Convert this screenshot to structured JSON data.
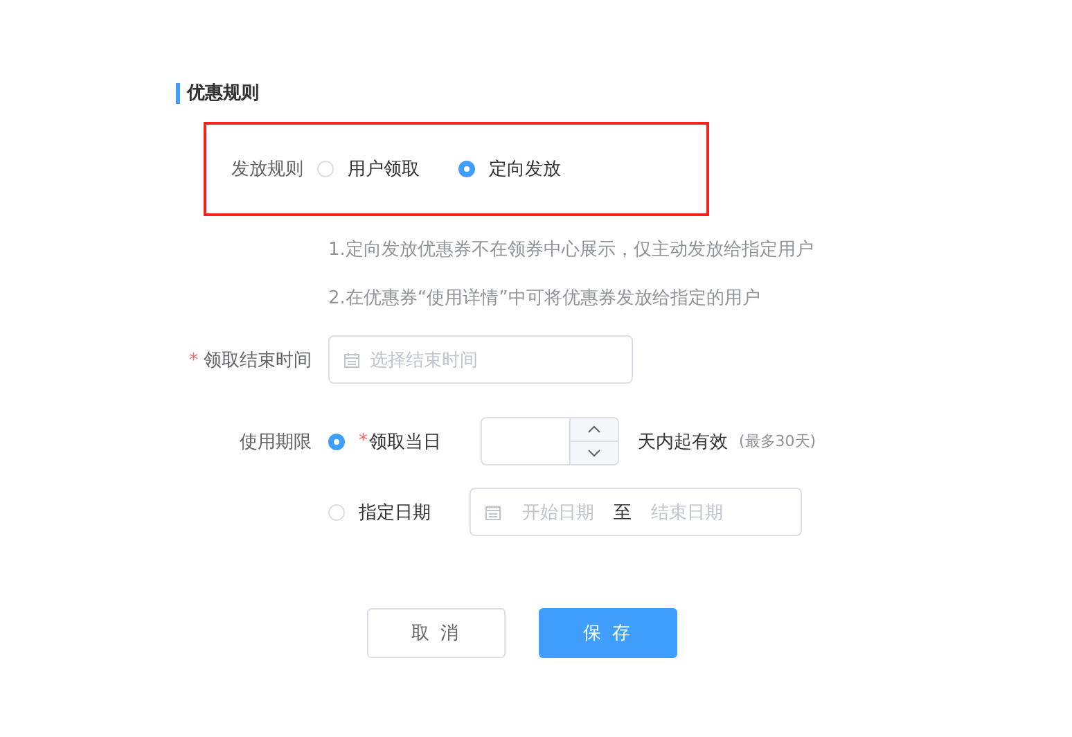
{
  "section": {
    "title": "优惠规则"
  },
  "issue_rule": {
    "label": "发放规则",
    "highlighted": true,
    "options": [
      {
        "label": "用户领取",
        "selected": false
      },
      {
        "label": "定向发放",
        "selected": true
      }
    ]
  },
  "notes": [
    "1.定向发放优惠券不在领券中心展示，仅主动发放给指定用户",
    "2.在优惠券“使用详情”中可将优惠券发放给指定的用户"
  ],
  "end_time": {
    "required_mark": "*",
    "label": "领取结束时间",
    "placeholder": "选择结束时间"
  },
  "validity": {
    "label": "使用期限",
    "options": [
      {
        "kind": "days",
        "required_mark": "*",
        "label": "领取当日",
        "selected": true,
        "suffix": "天内起有效",
        "hint": "(最多30天)"
      },
      {
        "kind": "range",
        "label": "指定日期",
        "selected": false,
        "start_placeholder": "开始日期",
        "separator": "至",
        "end_placeholder": "结束日期"
      }
    ]
  },
  "buttons": [
    {
      "kind": "cancel",
      "label": "取 消"
    },
    {
      "kind": "save",
      "label": "保 存"
    }
  ]
}
